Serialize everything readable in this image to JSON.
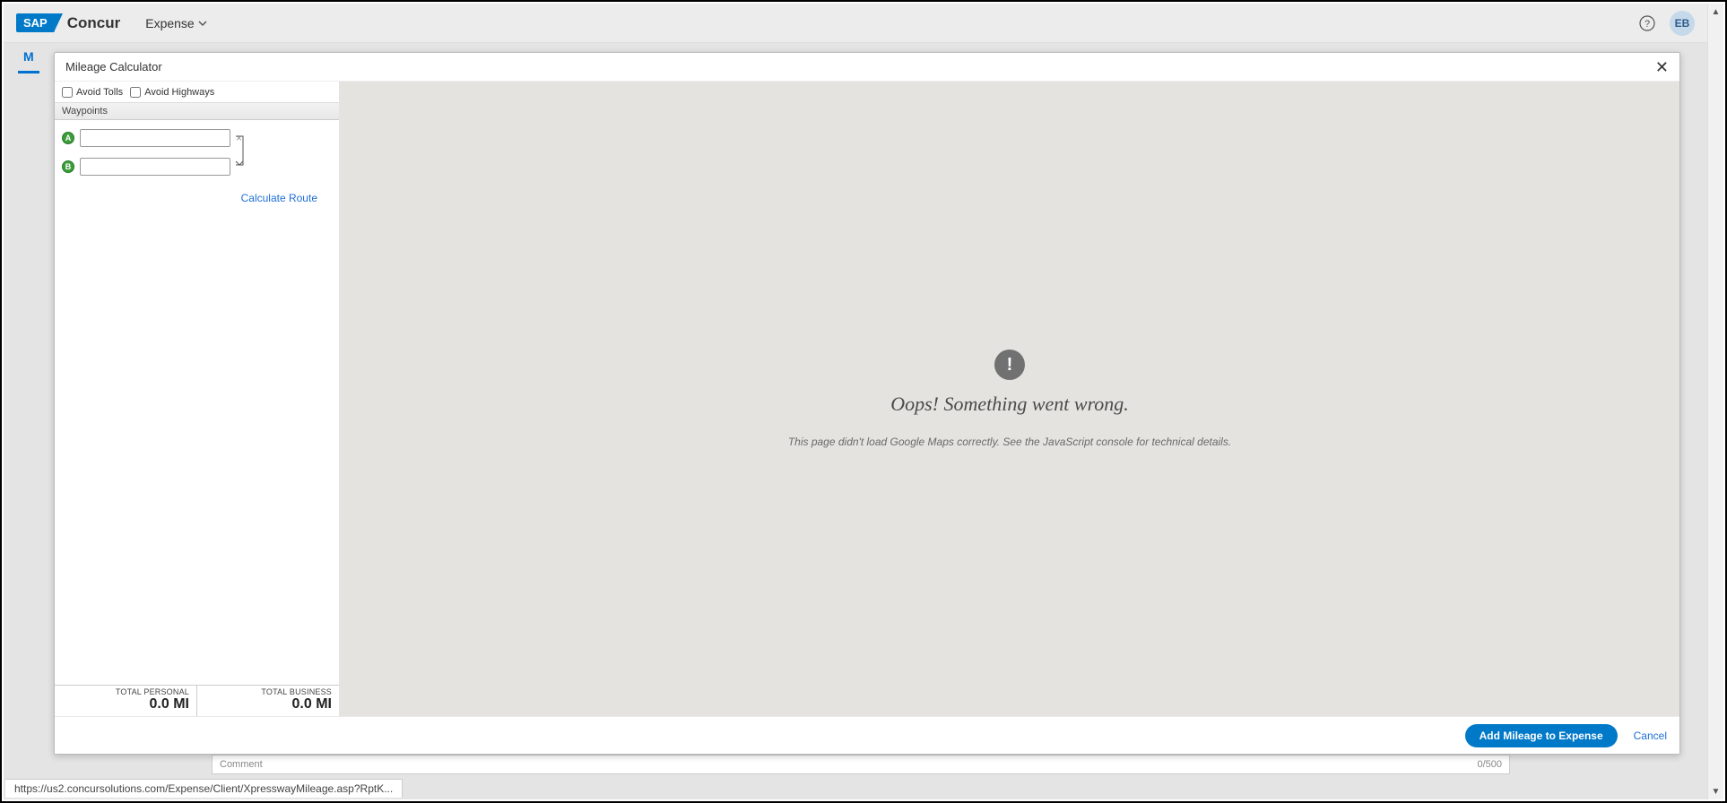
{
  "header": {
    "brand_sap": "SAP",
    "brand_concur": "Concur",
    "nav_expense": "Expense",
    "avatar_initials": "EB"
  },
  "background": {
    "tab_initial": "M",
    "comment_label": "Comment",
    "comment_count": "0/500",
    "status_url": "https://us2.concursolutions.com/Expense/Client/XpresswayMileage.asp?RptK..."
  },
  "modal": {
    "title": "Mileage Calculator",
    "avoid_tolls_label": "Avoid Tolls",
    "avoid_highways_label": "Avoid Highways",
    "avoid_tolls_checked": false,
    "avoid_highways_checked": false,
    "waypoints_header": "Waypoints",
    "waypoints": {
      "a": {
        "marker": "A",
        "value": ""
      },
      "b": {
        "marker": "B",
        "value": ""
      }
    },
    "calculate_route_label": "Calculate Route",
    "totals": {
      "personal_label": "TOTAL PERSONAL",
      "personal_value": "0.0 MI",
      "business_label": "TOTAL BUSINESS",
      "business_value": "0.0 MI"
    },
    "map_error": {
      "title": "Oops! Something went wrong.",
      "subtitle": "This page didn't load Google Maps correctly. See the JavaScript console for technical details."
    },
    "footer": {
      "add_label": "Add Mileage to Expense",
      "cancel_label": "Cancel"
    }
  }
}
